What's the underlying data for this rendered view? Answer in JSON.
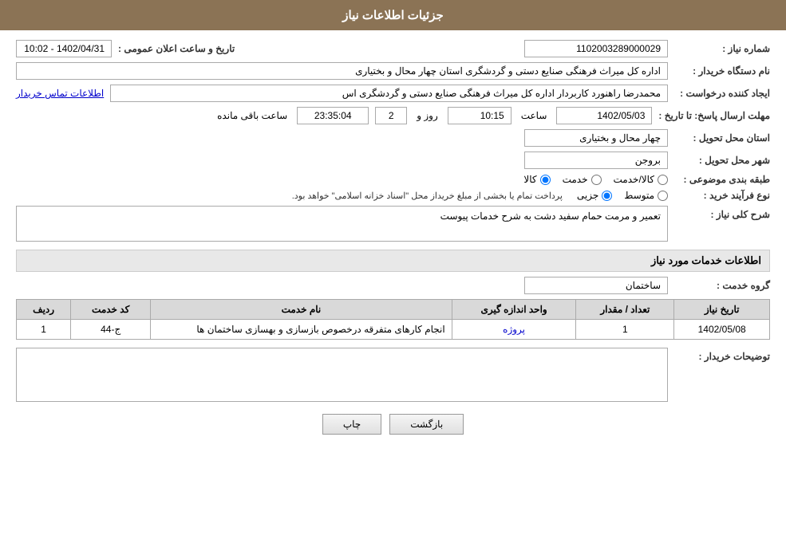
{
  "header": {
    "title": "جزئیات اطلاعات نیاز"
  },
  "fields": {
    "shomara_niaz_label": "شماره نیاز :",
    "shomara_niaz_value": "1102003289000029",
    "nam_dastgah_label": "نام دستگاه خریدار :",
    "nam_dastgah_value": "اداره کل میراث فرهنگی  صنایع دستی و گردشگری استان چهار محال و بختیاری",
    "ijad_label": "ایجاد کننده درخواست :",
    "ijad_value": "محمدرضا راهنورد کاربردار اداره کل میراث فرهنگی  صنایع دستی و گردشگری اس",
    "ijad_link": "اطلاعات تماس خریدار",
    "tarikh_label": "تاریخ و ساعت اعلان عمومی :",
    "tarikh_value": "1402/04/31 - 10:02",
    "mohlat_label": "مهلت ارسال پاسخ: تا تاریخ :",
    "mohlat_date": "1402/05/03",
    "mohlat_time": "10:15",
    "mohlat_rooz": "2",
    "mohlat_baqi": "23:35:04",
    "ostan_label": "استان محل تحویل :",
    "ostan_value": "چهار محال و بختیاری",
    "shahr_label": "شهر محل تحویل :",
    "shahr_value": "بروجن",
    "tabaqe_label": "طبقه بندی موضوعی :",
    "tabaqe_kala": "کالا",
    "tabaqe_khedmat": "خدمت",
    "tabaqe_kala_khedmat": "کالا/خدمت",
    "nooe_farayand_label": "نوع فرآیند خرید :",
    "nooe_jozii": "جزیی",
    "nooe_mootaset": "متوسط",
    "nooe_note": "پرداخت تمام یا بخشی از مبلغ خریداز محل \"اسناد خزانه اسلامی\" خواهد بود.",
    "sharh_label": "شرح کلی نیاز :",
    "sharh_value": "تعمیر و مرمت حمام سفید دشت به شرح خدمات پیوست",
    "service_section_title": "اطلاعات خدمات مورد نیاز",
    "grooh_khedmat_label": "گروه خدمت :",
    "grooh_khedmat_value": "ساختمان",
    "table_headers": {
      "radif": "ردیف",
      "kod_khedmat": "کد خدمت",
      "nam_khedmat": "نام خدمت",
      "vahed": "واحد اندازه گیری",
      "tedad": "تعداد / مقدار",
      "tarikh_niaz": "تاریخ نیاز"
    },
    "table_rows": [
      {
        "radif": "1",
        "kod": "ج-44",
        "name": "انجام کارهای متفرقه درخصوص بازسازی و بهسازی ساختمان ها",
        "vahed": "پروژه",
        "tedad": "1",
        "tarikh": "1402/05/08"
      }
    ],
    "tozihat_label": "توضیحات خریدار :",
    "tozihat_value": "",
    "btn_chap": "چاپ",
    "btn_bazgasht": "بازگشت",
    "baqi_mande_label": "ساعت باقی مانده",
    "rooz_label": "روز و"
  }
}
